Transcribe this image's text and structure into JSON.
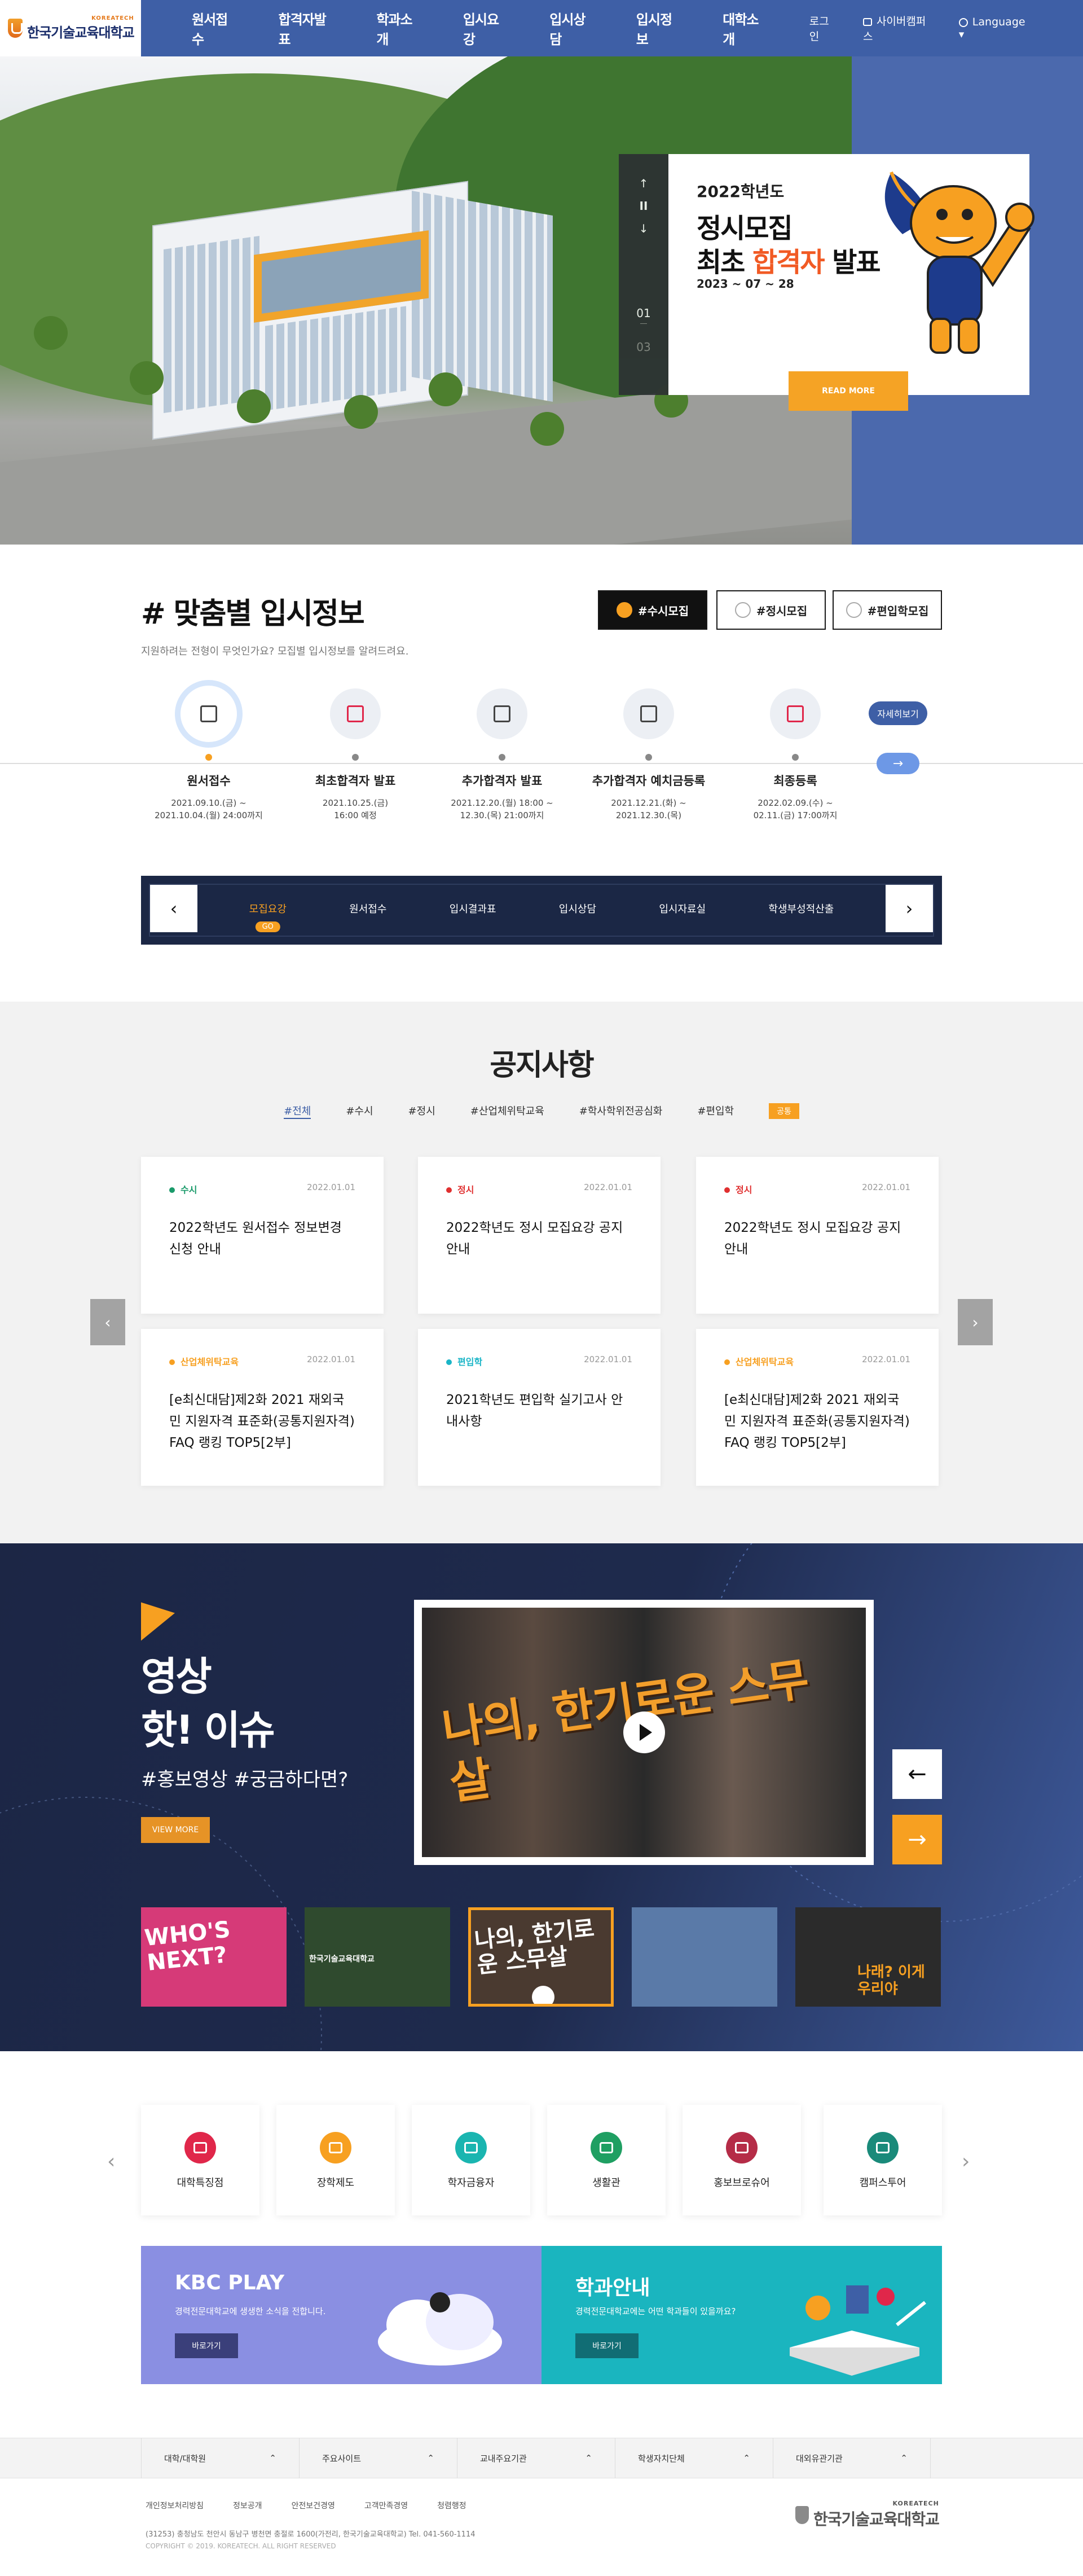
{
  "header": {
    "logo_eng": "KOREATECH",
    "logo_kor": "한국기술교육대학교",
    "nav": [
      "원서접수",
      "합격자발표",
      "학과소개",
      "입시요강",
      "입시상담",
      "입시정보",
      "대학소개"
    ],
    "util": {
      "login": "로그인",
      "cyber": "사이버캠퍼스",
      "language": "Language"
    }
  },
  "hero": {
    "year": "2022학년도",
    "title1": "정시모집",
    "title2_pre": "최초 ",
    "title2_em": "합격자",
    "title2_post": " 발표",
    "date": "2023 ~ 07 ~ 28",
    "more": "READ MORE",
    "page_current": "01",
    "page_total": "03",
    "ctrl_up": "↑",
    "ctrl_pause": "II",
    "ctrl_down": "↓"
  },
  "admission": {
    "title": "# 맞춤별 입시정보",
    "subtitle": "지원하려는 전형이 무엇인가요? 모집별 입시정보를 알려드려요.",
    "tags": [
      "#수시모집",
      "#정시모집",
      "#편입학모집"
    ],
    "steps": [
      {
        "name": "원서접수",
        "date1": "2021.09.10.(금) ~",
        "date2": "2021.10.04.(월) 24:00까지"
      },
      {
        "name": "최초합격자 발표",
        "date1": "2021.10.25.(금)",
        "date2": "16:00 예정"
      },
      {
        "name": "추가합격자 발표",
        "date1": "2021.12.20.(월) 18:00 ~",
        "date2": "12.30.(목) 21:00까지"
      },
      {
        "name": "추가합격자 예치금등록",
        "date1": "2021.12.21.(화) ~",
        "date2": "2021.12.30.(목)"
      },
      {
        "name": "최종등록",
        "date1": "2022.02.09.(수) ~",
        "date2": "02.11.(금) 17:00까지"
      }
    ],
    "detail_label": "자세히보기",
    "detail_arrow": "→",
    "quicknav": [
      "모집요강",
      "원서접수",
      "입시결과표",
      "입시상담",
      "입시자료실",
      "학생부성적산출"
    ],
    "quicknav_go": "GO",
    "prev": "‹",
    "next": "›"
  },
  "notice": {
    "title": "공지사항",
    "tabs": [
      "#전체",
      "#수시",
      "#정시",
      "#산업체위탁교육",
      "#학사학위전공심화",
      "#편입학"
    ],
    "tab_badge": "공통",
    "cards": [
      {
        "cat": "수시",
        "color": "#1a9a6a",
        "date": "2022.01.01",
        "title": "2022학년도 원서접수 정보변경 신청 안내"
      },
      {
        "cat": "정시",
        "color": "#e03030",
        "date": "2022.01.01",
        "title": "2022학년도 정시 모집요강 공지 안내"
      },
      {
        "cat": "정시",
        "color": "#e03030",
        "date": "2022.01.01",
        "title": "2022학년도 정시 모집요강 공지 안내"
      },
      {
        "cat": "산업체위탁교육",
        "color": "#f7a021",
        "date": "2022.01.01",
        "title": "[e최신대담]제2화 2021 재외국민 지원자격 표준화(공통지원자격) FAQ 랭킹 TOP5[2부]"
      },
      {
        "cat": "편입학",
        "color": "#1ab5c7",
        "date": "2022.01.01",
        "title": "2021학년도 편입학 실기고사 안내사항"
      },
      {
        "cat": "산업체위탁교육",
        "color": "#f7a021",
        "date": "2022.01.01",
        "title": "[e최신대담]제2화 2021 재외국민 지원자격 표준화(공통지원자격) FAQ 랭킹 TOP5[2부]"
      }
    ],
    "prev": "‹",
    "next": "›"
  },
  "video": {
    "title1": "영상",
    "title2": "핫! 이슈",
    "sub": "#홍보영상 #궁금하다면?",
    "more": "VIEW MORE",
    "main_caption": "나의, 한기로운 스무살",
    "prev": "←",
    "next": "→",
    "thumbs": [
      {
        "label": "WHO'S NEXT?",
        "bg": "#d63a78"
      },
      {
        "label": "한국기술교육대학교",
        "bg": "#2f4a2e"
      },
      {
        "label": "나의, 한기로운 스무살",
        "bg": "#4a3a30"
      },
      {
        "label": "",
        "bg": "#5a7aa8"
      },
      {
        "label": "나래? 이게 우리야",
        "bg": "#2b2b2b"
      }
    ]
  },
  "quicklinks": {
    "items": [
      {
        "name": "대학특징점",
        "color": "#e0274a"
      },
      {
        "name": "장학제도",
        "color": "#f7a021"
      },
      {
        "name": "학자금융자",
        "color": "#1ab5b0"
      },
      {
        "name": "생활관",
        "color": "#1f9f62"
      },
      {
        "name": "홍보브로슈어",
        "color": "#b52c47"
      },
      {
        "name": "캠퍼스투어",
        "color": "#1a8a7a"
      }
    ],
    "prev": "‹",
    "next": "›"
  },
  "banners": [
    {
      "title": "KBC PLAY",
      "desc": "경력전문대학교에 생생한 소식을 전합니다.",
      "button": "바로가기",
      "bg": "#8a8fe2",
      "btn_bg": "#3a3f7a"
    },
    {
      "title": "학과안내",
      "desc": "경력전문대학교에는 어떤 학과들이 있을까요?",
      "button": "바로가기",
      "bg": "#1ab5bf",
      "btn_bg": "#116d74"
    }
  ],
  "footer": {
    "selects": [
      "대학/대학원",
      "주요사이트",
      "교내주요기관",
      "학생자치단체",
      "대외유관기관"
    ],
    "links": [
      "개인정보처리방침",
      "정보공개",
      "안전보건경영",
      "고객만족경영",
      "청렴행정"
    ],
    "address": "(31253) 충청남도 천안시 동남구 병천면 충절로 1600(가전리, 한국기술교육대학교) Tel. 041-560-1114",
    "copyright": "COPYRIGHT © 2019. KOREATECH. ALL RIGHT RESERVED",
    "logo_eng": "KOREATECH",
    "logo_kor": "한국기술교육대학교"
  }
}
